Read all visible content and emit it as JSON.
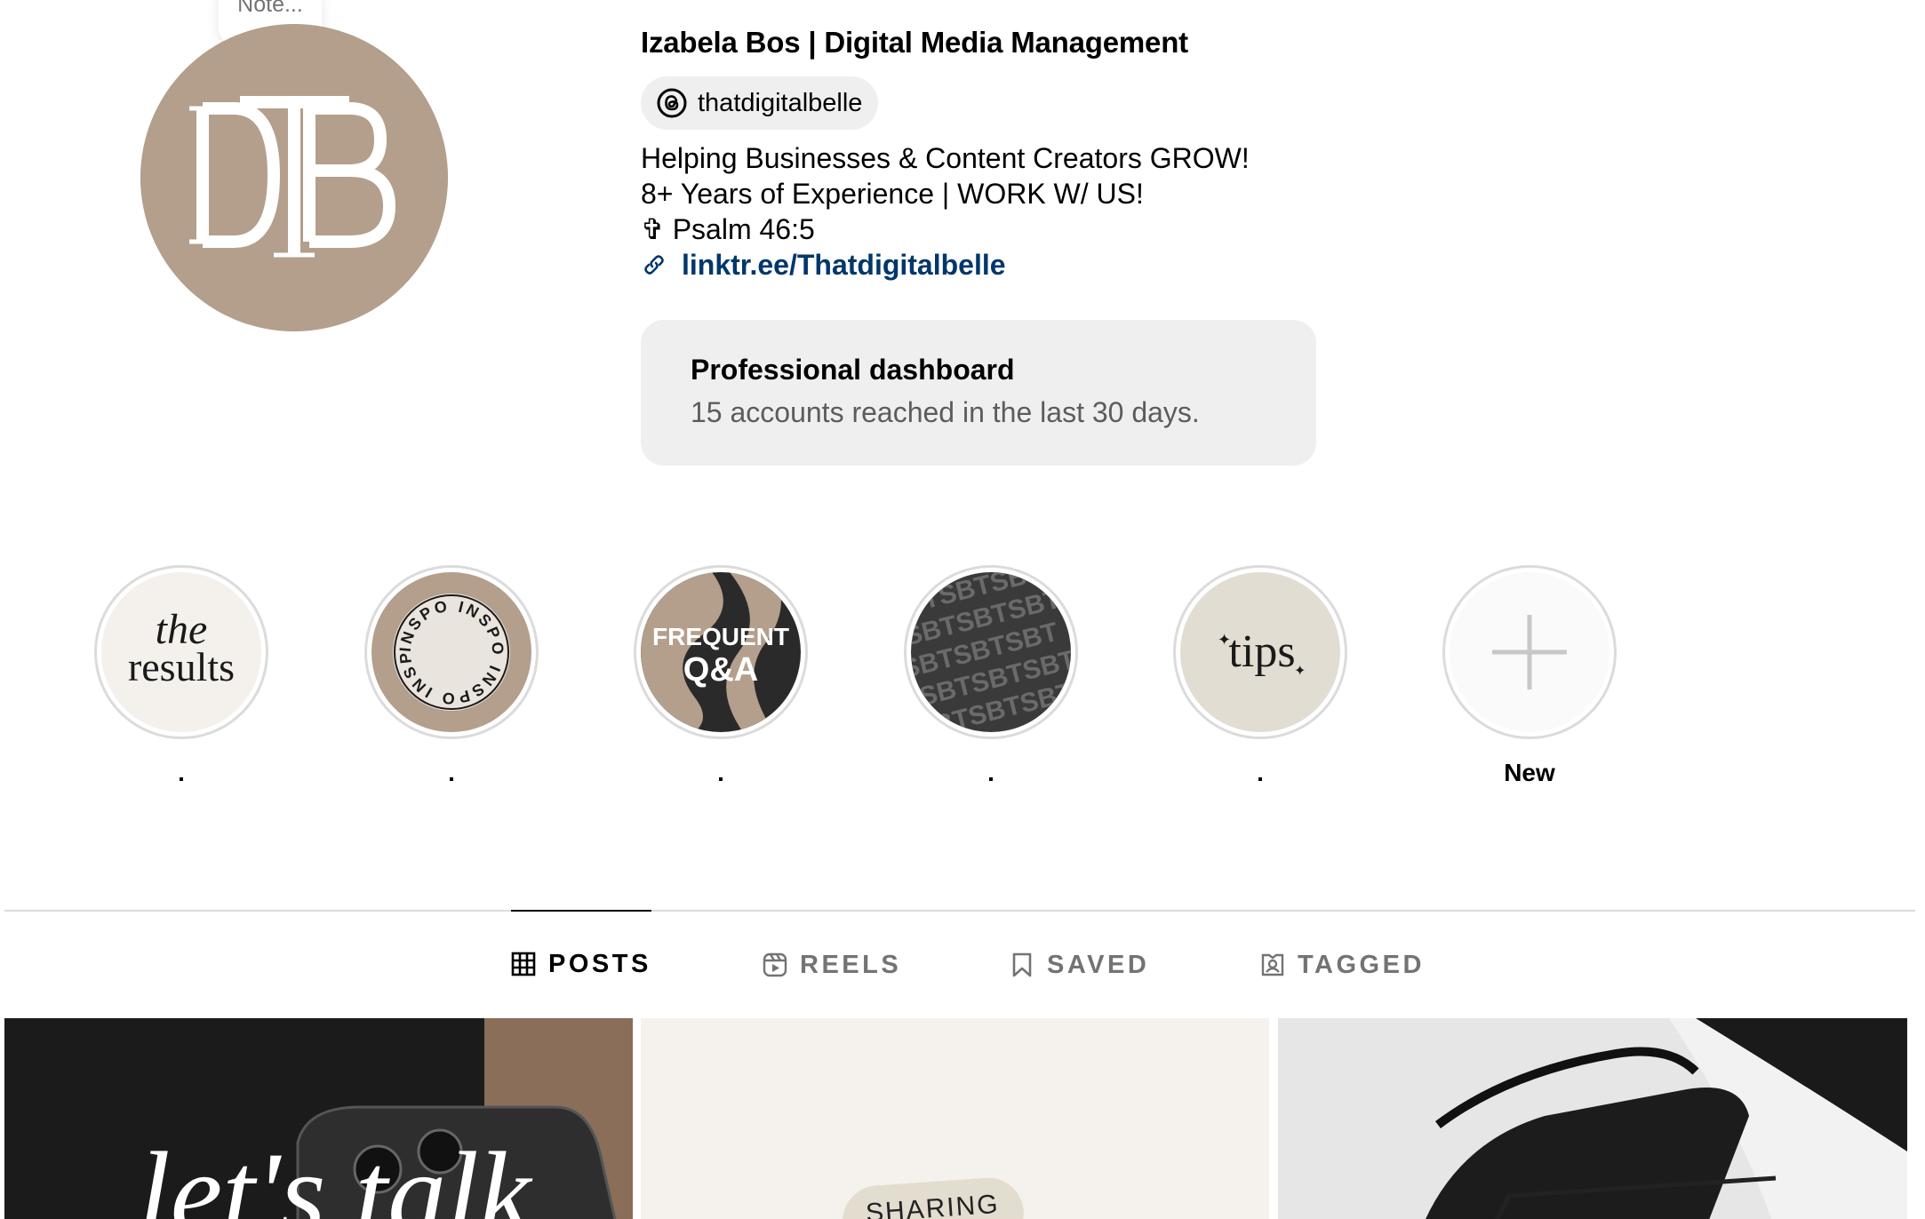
{
  "note": {
    "placeholder": "Note..."
  },
  "profile": {
    "name": "Izabela Bos | Digital Media Management",
    "threads_handle": "thatdigitalbelle",
    "bio_lines": [
      "Helping Businesses & Content Creators GROW!",
      "8+ Years of Experience | WORK W/ US!",
      "✞ Psalm 46:5"
    ],
    "link": "linktr.ee/Thatdigitalbelle",
    "avatar_monogram": "TDB"
  },
  "dashboard": {
    "title": "Professional dashboard",
    "subtitle": "15 accounts reached in the last 30 days."
  },
  "highlights": [
    {
      "label": ".",
      "cover_text": "the results",
      "cover": "the-results"
    },
    {
      "label": ".",
      "cover_text": "INSPO INSPO",
      "cover": "inspo"
    },
    {
      "label": ".",
      "cover_text": "FREQUENT Q&A",
      "cover": "frequent-qa"
    },
    {
      "label": ".",
      "cover_text": "BTS",
      "cover": "bts"
    },
    {
      "label": ".",
      "cover_text": "tips",
      "cover": "tips"
    },
    {
      "label": "New",
      "cover": "new-plus"
    }
  ],
  "tabs": [
    {
      "label": "POSTS",
      "icon": "grid-icon",
      "active": true
    },
    {
      "label": "REELS",
      "icon": "reels-icon",
      "active": false
    },
    {
      "label": "SAVED",
      "icon": "bookmark-icon",
      "active": false
    },
    {
      "label": "TAGGED",
      "icon": "tagged-icon",
      "active": false
    }
  ],
  "posts": [
    {
      "caption": "let's talk"
    },
    {
      "caption": "SHARING"
    },
    {
      "caption": ""
    }
  ],
  "colors": {
    "avatar_bg": "#b39f8c",
    "link": "#00376b",
    "pill_bg": "#efefef",
    "muted_text": "#737373"
  }
}
